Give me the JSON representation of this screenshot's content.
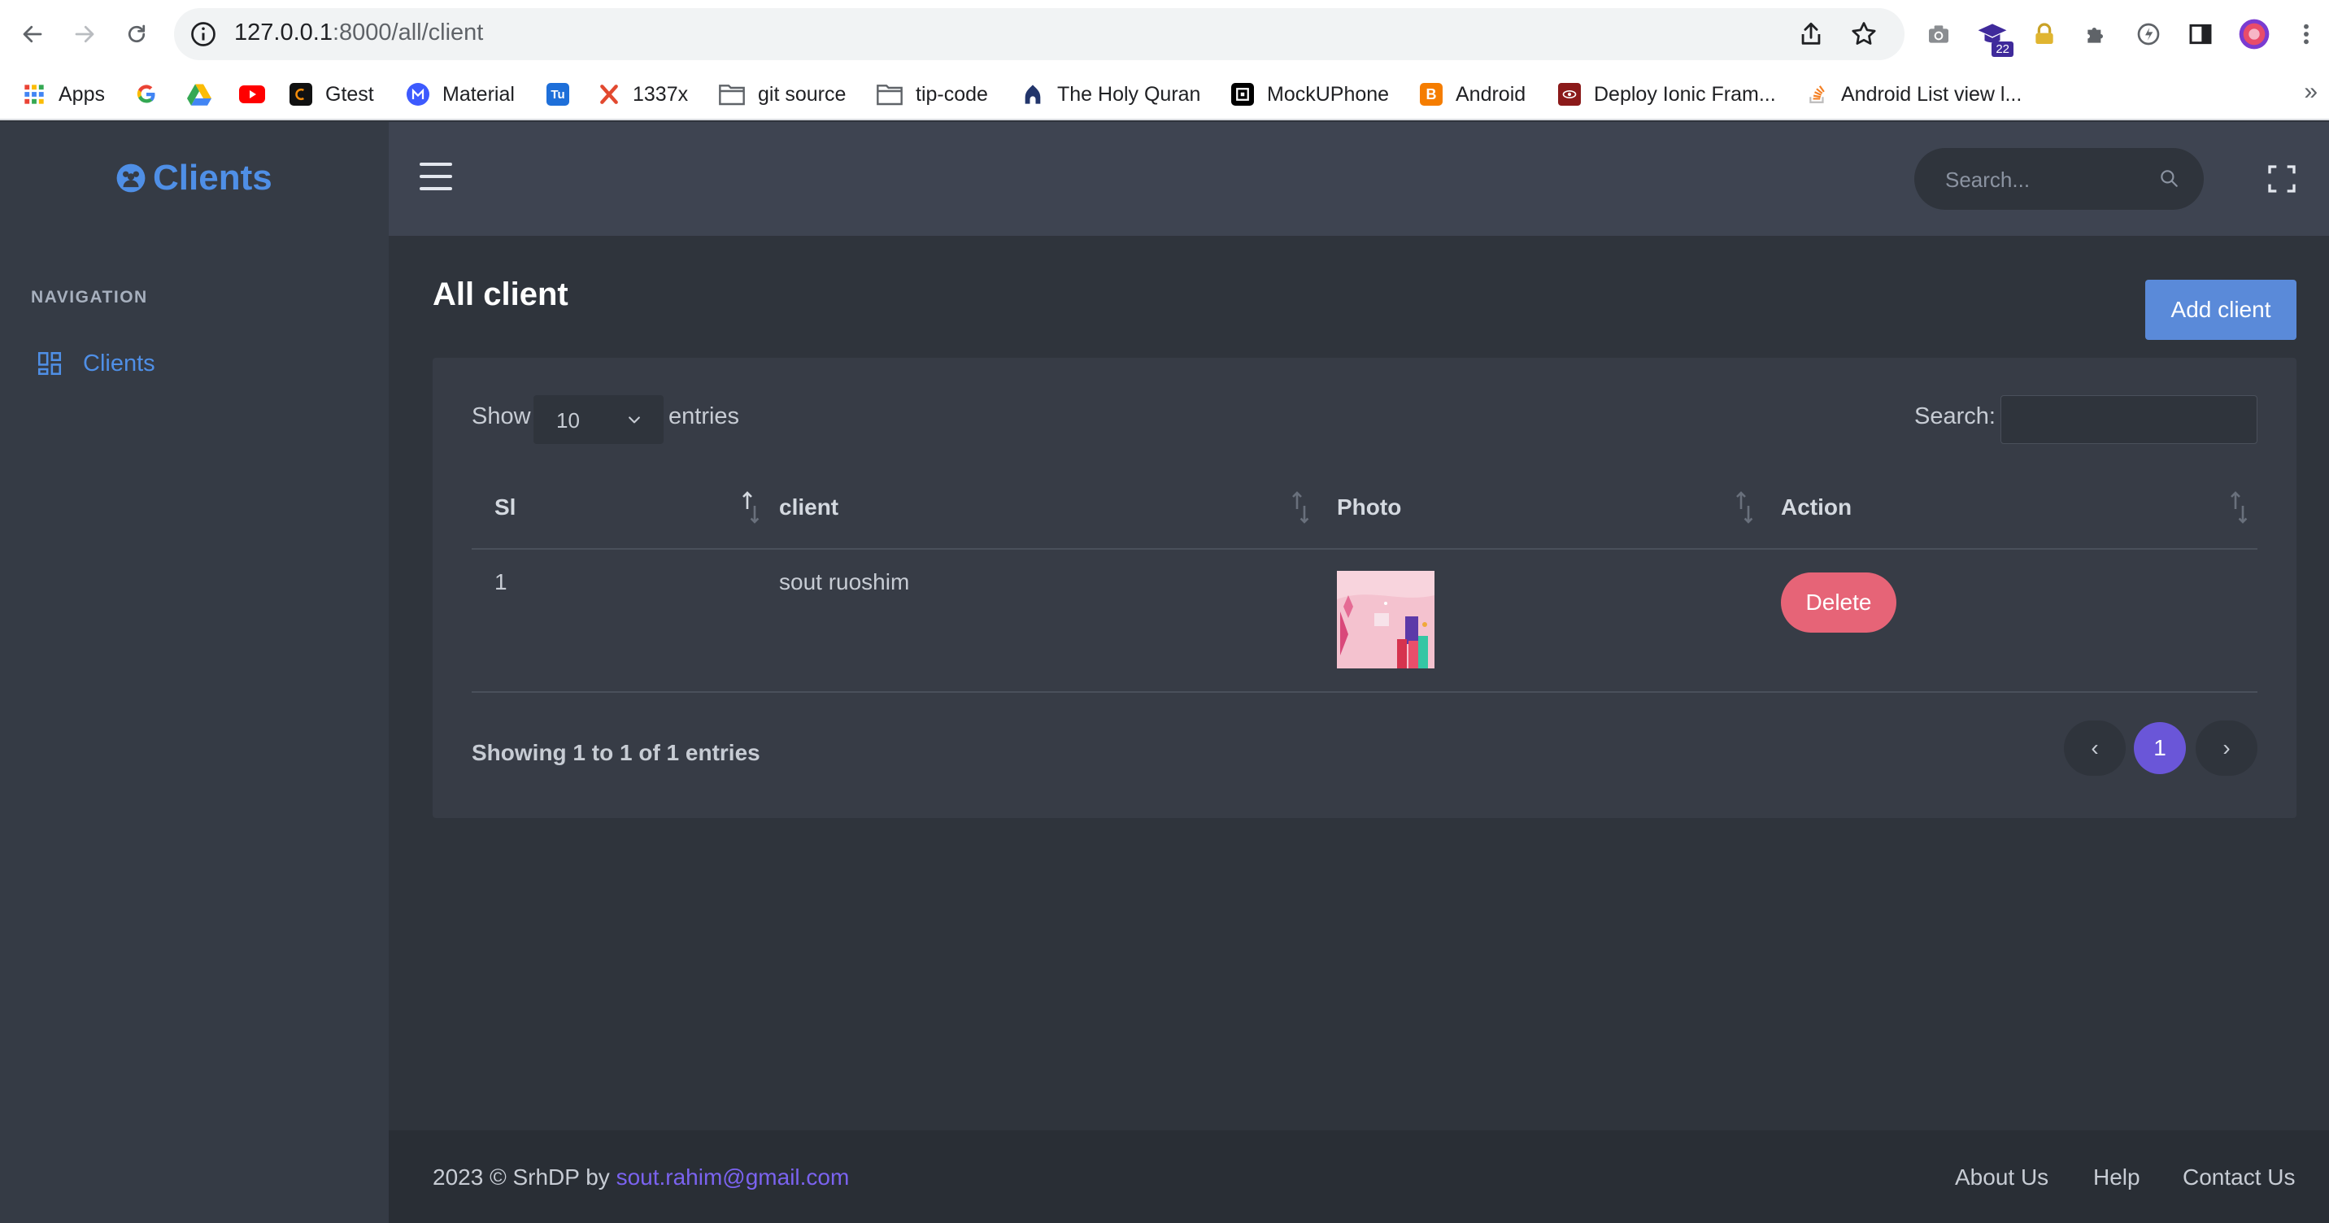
{
  "browser": {
    "url_host": "127.0.0.1",
    "url_path": ":8000/all/client",
    "profile_badge": "22",
    "bookmarks": [
      {
        "label": "Apps",
        "icon": "apps-grid-icon"
      },
      {
        "label": "",
        "icon": "google-icon"
      },
      {
        "label": "",
        "icon": "google-drive-icon"
      },
      {
        "label": "",
        "icon": "youtube-icon"
      },
      {
        "label": "Gtest",
        "icon": "gtest-icon"
      },
      {
        "label": "Material",
        "icon": "material-icon"
      },
      {
        "label": "",
        "icon": "tu-icon"
      },
      {
        "label": "1337x",
        "icon": "1337x-icon"
      },
      {
        "label": "git source",
        "icon": "folder-icon"
      },
      {
        "label": "tip-code",
        "icon": "folder-icon"
      },
      {
        "label": "The Holy Quran",
        "icon": "quran-icon"
      },
      {
        "label": "MockUPhone",
        "icon": "mockuphone-icon"
      },
      {
        "label": "Android",
        "icon": "blogger-icon"
      },
      {
        "label": "Deploy Ionic Fram...",
        "icon": "ionic-icon"
      },
      {
        "label": "Android List view l...",
        "icon": "stackoverflow-icon"
      }
    ],
    "more": "»"
  },
  "sidebar": {
    "logo_text": "Clients",
    "nav_heading": "NAVIGATION",
    "items": [
      {
        "label": "Clients",
        "icon": "grid-icon"
      }
    ]
  },
  "topbar": {
    "search_placeholder": "Search..."
  },
  "main": {
    "title": "All client",
    "add_button": "Add client",
    "show_label": "Show",
    "entries_value": "10",
    "entries_label": "entries",
    "search_label": "Search:",
    "columns": [
      "Sl",
      "client",
      "Photo",
      "Action"
    ],
    "rows": [
      {
        "sl": "1",
        "client": "sout ruoshim",
        "action": "Delete"
      }
    ],
    "info": "Showing 1 to 1 of 1 entries",
    "pagination": {
      "prev": "‹",
      "current": "1",
      "next": "›"
    }
  },
  "footer": {
    "copyright": "2023 © SrhDP by ",
    "email": "sout.rahim@gmail.com",
    "links": [
      "About Us",
      "Help",
      "Contact Us"
    ]
  },
  "colors": {
    "accent": "#4f8fe6",
    "primary_button": "#5a8ad9",
    "danger": "#e66477",
    "pagination_active": "#6a56d8"
  }
}
